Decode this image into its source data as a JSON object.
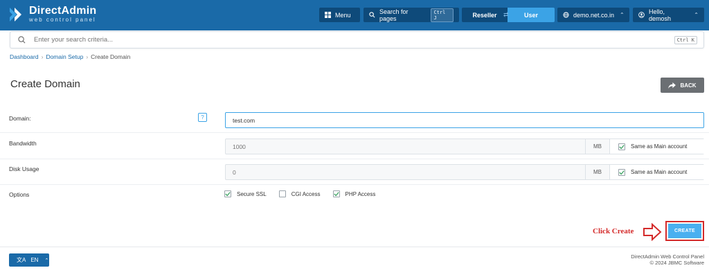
{
  "header": {
    "logo_title": "DirectAdmin",
    "logo_subtitle": "web control panel",
    "menu_label": "Menu",
    "search_pages_label": "Search for pages",
    "search_pages_shortcut": "Ctrl J",
    "role_reseller": "Reseller",
    "role_user": "User",
    "domain_select": "demo.net.co.in",
    "user_greeting": "Hello, demosh",
    "brand_color": "#1a6aa8",
    "active_color": "#3ba3e6"
  },
  "search": {
    "placeholder": "Enter your search criteria...",
    "shortcut": "Ctrl K"
  },
  "breadcrumb": {
    "items": [
      "Dashboard",
      "Domain Setup",
      "Create Domain"
    ],
    "separator": "›"
  },
  "page": {
    "title": "Create Domain",
    "back_label": "BACK"
  },
  "form": {
    "domain": {
      "label": "Domain:",
      "help": "?",
      "value": "test.com"
    },
    "bandwidth": {
      "label": "Bandwidth",
      "placeholder": "1000",
      "unit": "MB",
      "same_label": "Same as Main account",
      "same_checked": true
    },
    "disk_usage": {
      "label": "Disk Usage",
      "placeholder": "0",
      "unit": "MB",
      "same_label": "Same as Main account",
      "same_checked": true
    },
    "options": {
      "label": "Options",
      "items": [
        {
          "label": "Secure SSL",
          "checked": true
        },
        {
          "label": "CGI Access",
          "checked": false
        },
        {
          "label": "PHP Access",
          "checked": true
        }
      ]
    }
  },
  "annotation": {
    "text": "Click Create",
    "color": "#d42a2a"
  },
  "create_label": "CREATE",
  "footer": {
    "language": "EN",
    "line1": "DirectAdmin Web Control Panel",
    "line2": "© 2024 JBMC Software"
  }
}
